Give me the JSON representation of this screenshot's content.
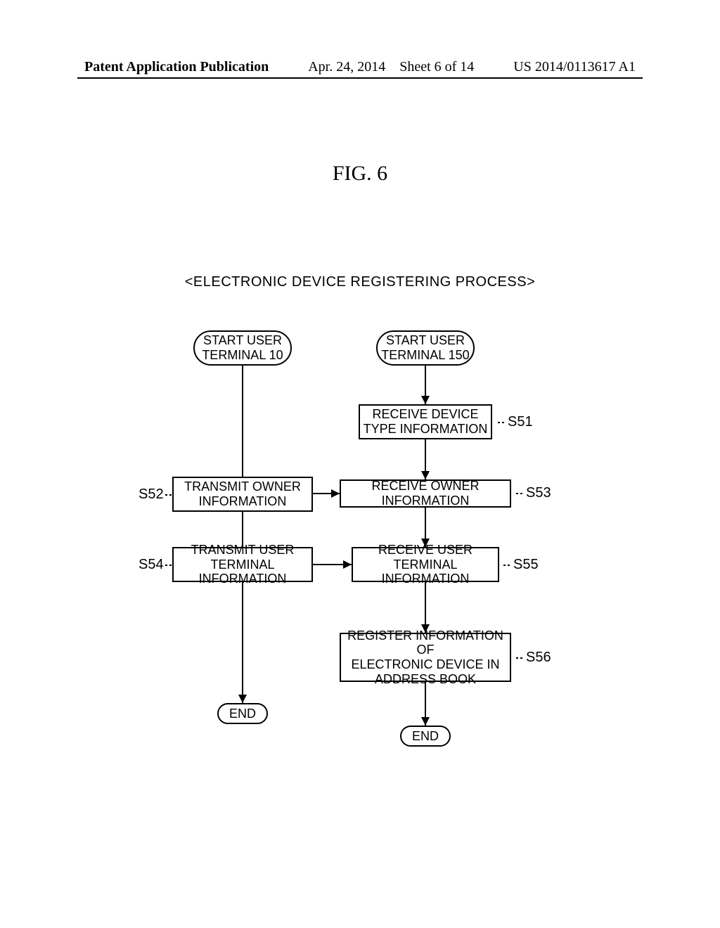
{
  "header": {
    "left": "Patent Application Publication",
    "mid_date": "Apr. 24, 2014",
    "mid_sheet": "Sheet 6 of 14",
    "right": "US 2014/0113617 A1"
  },
  "figure_title": "FIG. 6",
  "subtitle": "<ELECTRONIC DEVICE REGISTERING PROCESS>",
  "left_col": {
    "start": "START USER\nTERMINAL 10",
    "s52": "TRANSMIT OWNER\nINFORMATION",
    "s54": "TRANSMIT USER\nTERMINAL INFORMATION",
    "end": "END"
  },
  "right_col": {
    "start": "START USER\nTERMINAL 150",
    "s51": "RECEIVE DEVICE\nTYPE INFORMATION",
    "s53": "RECEIVE OWNER INFORMATION",
    "s55": "RECEIVE USER\nTERMINAL INFORMATION",
    "s56": "REGISTER INFORMATION OF\nELECTRONIC DEVICE IN\nADDRESS BOOK",
    "end": "END"
  },
  "labels": {
    "s51": "S51",
    "s52": "S52",
    "s53": "S53",
    "s54": "S54",
    "s55": "S55",
    "s56": "S56"
  }
}
